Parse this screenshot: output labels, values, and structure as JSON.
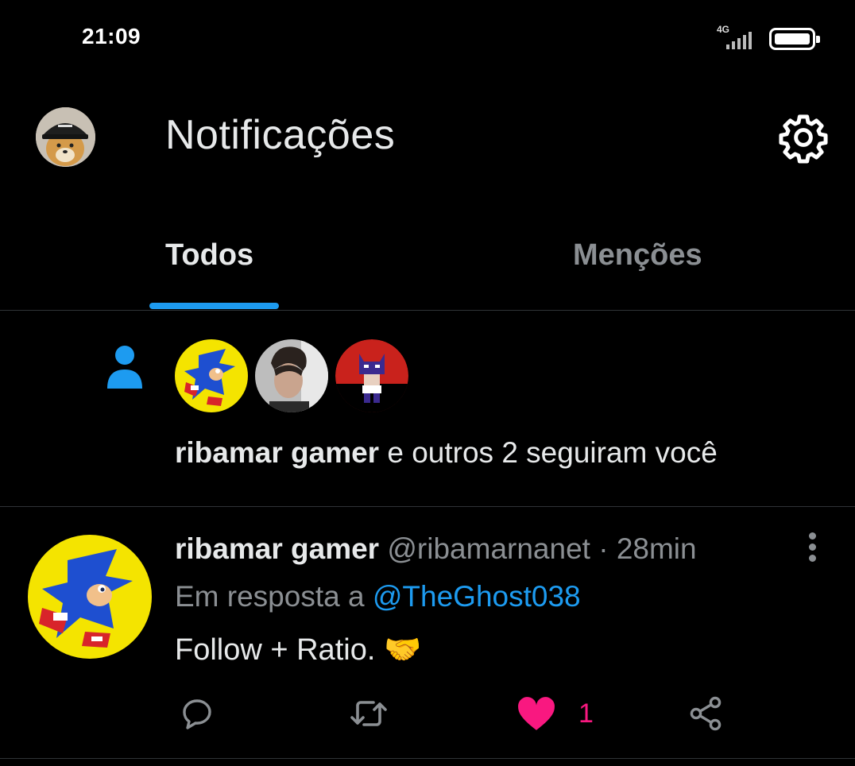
{
  "status_bar": {
    "time": "21:09",
    "network": "4G"
  },
  "header": {
    "title": "Notificações",
    "settings_icon": "gear-icon"
  },
  "tabs": [
    {
      "label": "Todos",
      "selected": true
    },
    {
      "label": "Menções",
      "selected": false
    }
  ],
  "follow_notification": {
    "icon": "person-icon",
    "name": "ribamar gamer",
    "text": " e outros 2 seguiram você"
  },
  "reply_tweet": {
    "name": "ribamar gamer",
    "handle": "@ribamarnanet",
    "separator": " · ",
    "time": "28min",
    "reply_prefix": "Em resposta a ",
    "reply_to": "@TheGhost038",
    "text": "Follow + Ratio. 🤝",
    "likes": "1",
    "liked": true
  },
  "colors": {
    "accent": "#1d9bf0",
    "like": "#f91880",
    "background": "#000000",
    "muted": "#8b8f93"
  }
}
